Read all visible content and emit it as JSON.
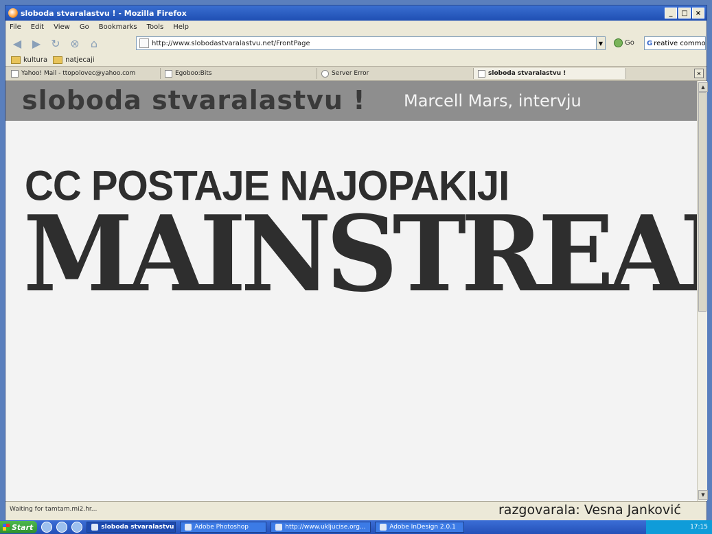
{
  "window": {
    "title": "sloboda stvaralastvu ! - Mozilla Firefox",
    "buttons": [
      "_",
      "□",
      "×"
    ]
  },
  "menu": [
    "File",
    "Edit",
    "View",
    "Go",
    "Bookmarks",
    "Tools",
    "Help"
  ],
  "nav": {
    "url": "http://www.slobodastvaralastvu.net/FrontPage",
    "go_label": "Go",
    "search_value": "reative commons hr"
  },
  "bookmarks": [
    "kultura",
    "natjecaji"
  ],
  "tabs": [
    {
      "label": "Yahoo! Mail - ttopolovec@yahoo.com"
    },
    {
      "label": "Egoboo:Bits"
    },
    {
      "label": "Server Error"
    },
    {
      "label": "sloboda stvaralastvu !"
    }
  ],
  "page": {
    "site_title": "sloboda stvaralastvu !",
    "subtitle": "Marcell Mars, intervju",
    "headline_line1": "CC POSTAJE NAJOPAKIJI",
    "headline_line2": "MAINSTREAM",
    "byline": "razgovarala: Vesna Janković"
  },
  "status": {
    "text": "Waiting for tamtam.mi2.hr..."
  },
  "taskbar": {
    "start_label": "Start",
    "tasks": [
      {
        "label": "sloboda stvaralastvu ...",
        "active": true
      },
      {
        "label": "Adobe Photoshop",
        "active": false
      },
      {
        "label": "http://www.ukljucise.org...",
        "active": false
      },
      {
        "label": "Adobe InDesign 2.0.1",
        "active": false
      }
    ],
    "clock": "17:15"
  },
  "colors": {
    "banner": "#8e8e8e",
    "titlebar": "#2556c0",
    "headline": "#2e2e2e"
  }
}
